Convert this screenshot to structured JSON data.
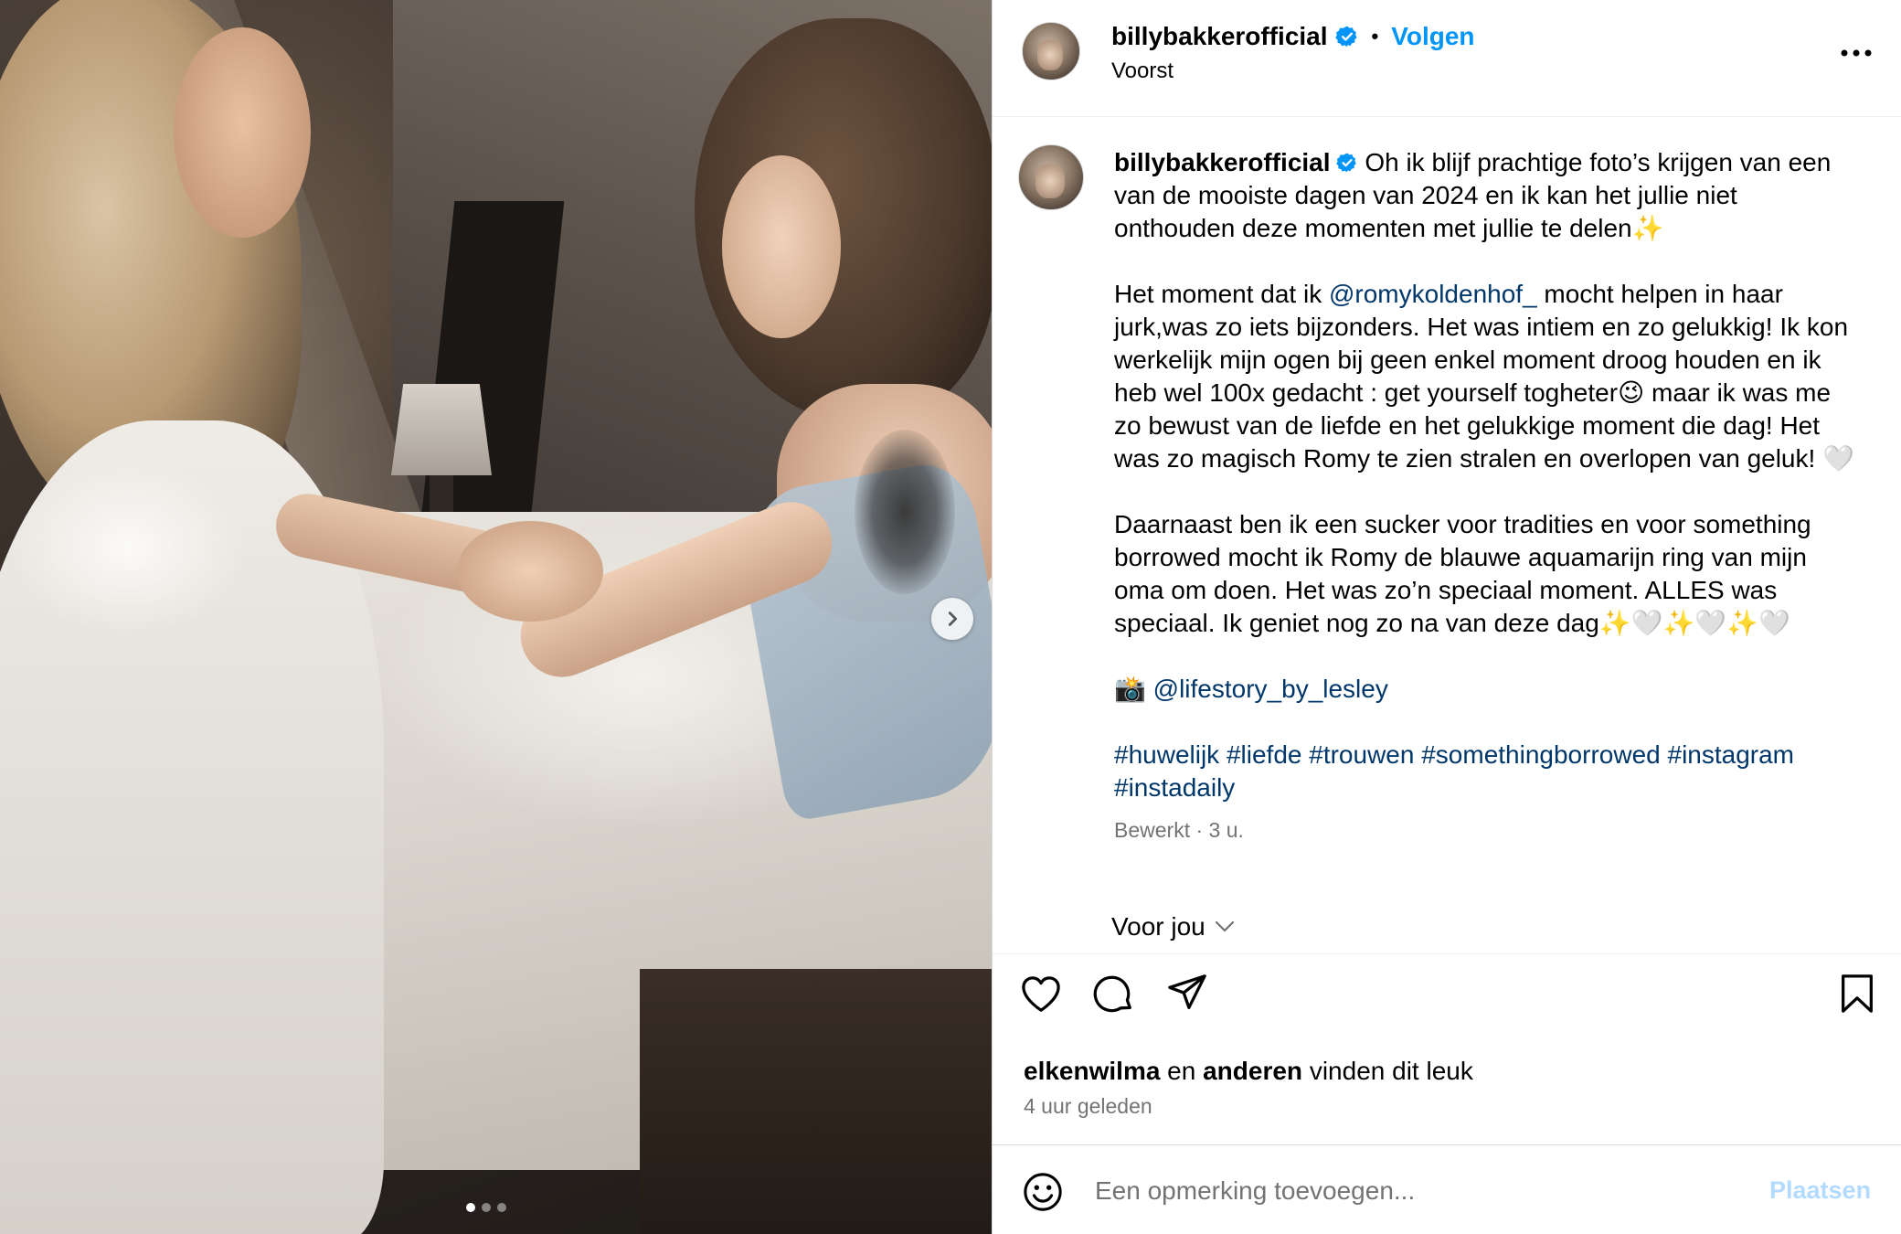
{
  "post": {
    "username": "billybakkerofficial",
    "follow_label": "Volgen",
    "separator": "•",
    "location": "Voorst",
    "more_label": "Meer opties"
  },
  "carousel": {
    "total": 3,
    "active_index": 0
  },
  "caption": {
    "username": "billybakkerofficial",
    "p1_text": " Oh ik blijf prachtige foto’s krijgen van een van de mooiste dagen van 2024 en ik kan het jullie niet onthouden deze momenten met jullie te delen✨",
    "p2_before": "Het moment dat ik ",
    "p2_mention": "@romykoldenhof_",
    "p2_after": " mocht helpen in haar jurk,was zo iets bijzonders. Het was intiem en zo gelukkig! Ik kon werkelijk mijn ogen bij geen enkel moment droog houden en ik heb wel 100x gedacht : get yourself togheter😉 maar ik was me zo bewust van de liefde en het gelukkige moment die dag! Het was zo magisch Romy te zien stralen en overlopen van geluk! 🤍",
    "p3_text": "Daarnaast ben ik een sucker voor tradities en voor something borrowed mocht ik Romy de blauwe aquamarijn ring van mijn oma om doen. Het was zo’n speciaal moment. ALLES was speciaal. Ik geniet nog zo na van deze dag✨🤍✨🤍✨🤍",
    "p4_emoji": "📸 ",
    "p4_mention": "@lifestory_by_lesley",
    "hashtags": [
      "#huwelijk",
      "#liefde",
      "#trouwen",
      "#somethingborrowed",
      "#instagram",
      "#instadaily"
    ],
    "meta": "Bewerkt · 3 u."
  },
  "for_you": {
    "label": "Voor jou"
  },
  "engagement": {
    "liker": "elkenwilma",
    "connector": " en ",
    "others": "anderen",
    "suffix": " vinden dit leuk",
    "time": "4 uur geleden"
  },
  "comment": {
    "placeholder": "Een opmerking toevoegen...",
    "post_label": "Plaatsen"
  },
  "colors": {
    "accent": "#0095f6",
    "link": "#00376b",
    "muted": "#737373",
    "post_disabled": "#b3dbff"
  },
  "icons": [
    "verified-badge-icon",
    "more-options-icon",
    "heart-icon",
    "comment-icon",
    "share-icon",
    "bookmark-icon",
    "emoji-icon",
    "chevron-right-icon",
    "chevron-down-icon"
  ]
}
